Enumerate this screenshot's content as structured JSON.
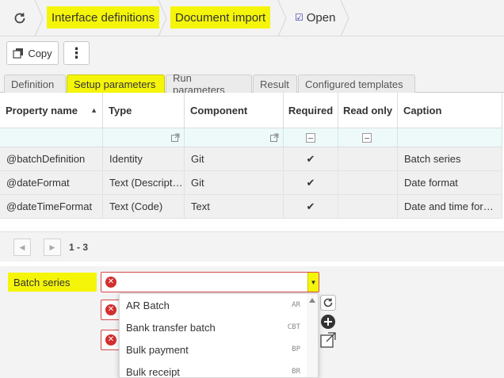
{
  "breadcrumb": {
    "items": [
      "Interface definitions",
      "Document import"
    ],
    "open_label": "Open"
  },
  "toolbar": {
    "copy_label": "Copy",
    "more_label": "⋮"
  },
  "tabs": [
    "Definition",
    "Setup parameters",
    "Run parameters",
    "Result",
    "Configured templates"
  ],
  "active_tab": "Setup parameters",
  "grid": {
    "columns": [
      "Property name",
      "Type",
      "Component",
      "Required",
      "Read only",
      "Caption"
    ],
    "sort_indicator": "▲",
    "rows": [
      {
        "property": "@batchDefinition",
        "type": "Identity",
        "component": "Git",
        "required": "✔",
        "caption": "Batch series"
      },
      {
        "property": "@dateFormat",
        "type": "Text (Descript…",
        "component": "Git",
        "required": "✔",
        "caption": "Date format"
      },
      {
        "property": "@dateTimeFormat",
        "type": "Text (Code)",
        "component": "Text",
        "required": "✔",
        "caption": "Date and time for…"
      }
    ]
  },
  "pager": {
    "prev": "◀",
    "next": "▶",
    "range": "1 - 3"
  },
  "form": {
    "field_label": "Batch series",
    "error_mark": "✕",
    "dropdown_arrow": "▼"
  },
  "dropdown": {
    "options": [
      {
        "label": "AR Batch",
        "code": "AR"
      },
      {
        "label": "Bank transfer batch",
        "code": "CBT"
      },
      {
        "label": "Bulk payment",
        "code": "BP"
      },
      {
        "label": "Bulk receipt",
        "code": "BR"
      }
    ]
  },
  "colors": {
    "highlight": "#f5f50a",
    "error": "#d32f2f",
    "filter_row": "#eefafa",
    "row_bg": "#f0f0f0"
  },
  "icons": [
    "refresh-icon",
    "open-icon",
    "copy-icon",
    "more-icon",
    "sort-asc-icon",
    "filter-popout-icon",
    "error-icon",
    "refresh-list-icon",
    "add-icon",
    "external-link-icon"
  ]
}
